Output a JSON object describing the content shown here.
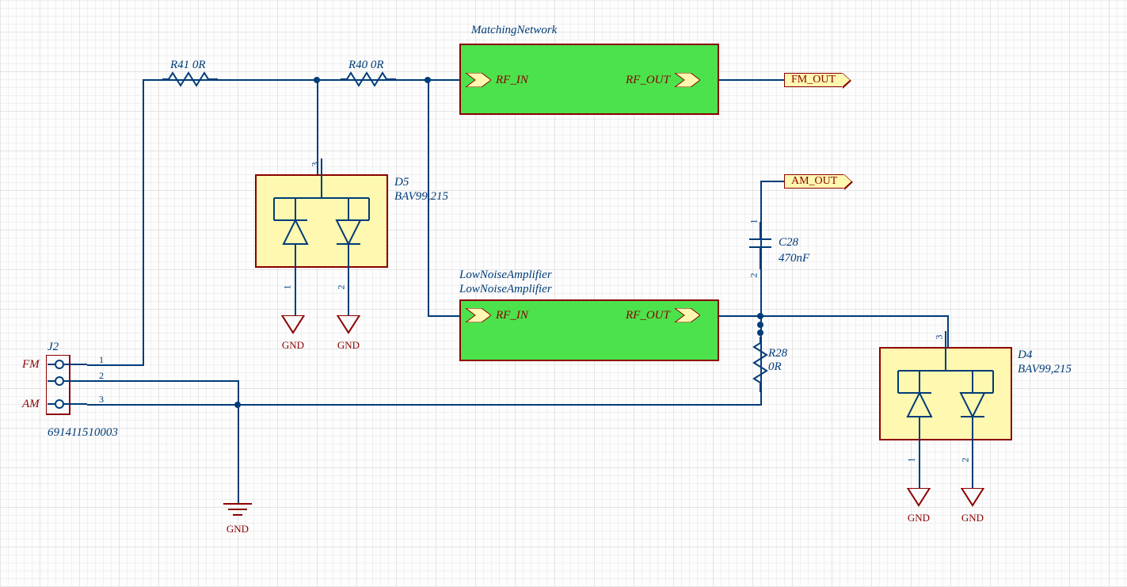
{
  "blocks": {
    "matching": {
      "title": "MatchingNetwork",
      "in": "RF_IN",
      "out": "RF_OUT"
    },
    "lna": {
      "title1": "LowNoiseAmplifier",
      "title2": "LowNoiseAmplifier",
      "in": "RF_IN",
      "out": "RF_OUT"
    }
  },
  "connector": {
    "ref": "J2",
    "part": "691411510003",
    "p1": "1",
    "p2": "2",
    "p3": "3",
    "l1": "FM",
    "l2": "AM"
  },
  "components": {
    "r41": {
      "ref": "R41",
      "val": "0R"
    },
    "r40": {
      "ref": "R40",
      "val": "0R"
    },
    "r28": {
      "ref": "R28",
      "val": "0R"
    },
    "c28": {
      "ref": "C28",
      "val": "470nF",
      "p1": "1",
      "p2": "2"
    },
    "d5": {
      "ref": "D5",
      "part": "BAV99,215",
      "p1": "1",
      "p2": "2",
      "p3": "3"
    },
    "d4": {
      "ref": "D4",
      "part": "BAV99,215",
      "p1": "1",
      "p2": "2",
      "p3": "3"
    }
  },
  "nets": {
    "fm": "FM_OUT",
    "am": "AM_OUT"
  },
  "gnd": "GND"
}
